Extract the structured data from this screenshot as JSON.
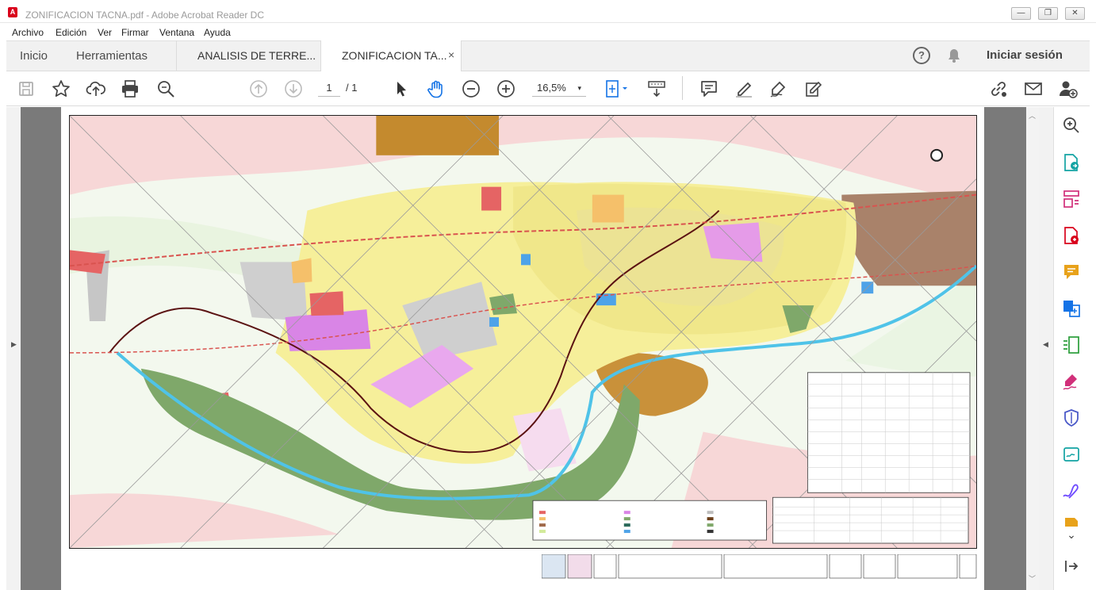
{
  "window": {
    "title": "ZONIFICACION TACNA.pdf - Adobe Acrobat Reader DC",
    "minimize": "—",
    "restore": "❐",
    "close": "✕"
  },
  "menu": [
    "Archivo",
    "Edición",
    "Ver",
    "Firmar",
    "Ventana",
    "Ayuda"
  ],
  "tabs": {
    "home": "Inicio",
    "tools": "Herramientas",
    "documents": [
      {
        "label": "ANALISIS DE TERRE...",
        "active": false
      },
      {
        "label": "ZONIFICACION TA...",
        "active": true,
        "close": "×"
      }
    ],
    "help": "?",
    "signin": "Iniciar sesión"
  },
  "toolbar": {
    "page_current": "1",
    "page_total": "/ 1",
    "zoom": "16,5%",
    "zoom_caret": "▾"
  },
  "icons": {
    "toolbar": [
      "save-icon",
      "star-icon",
      "upload-cloud-icon",
      "print-icon",
      "search-zoom-icon",
      "prev-page-icon",
      "next-page-icon",
      "select-cursor-icon",
      "hand-icon",
      "zoom-out-icon",
      "zoom-in-icon",
      "fit-page-icon",
      "scroll-mode-icon",
      "comment-icon",
      "highlight-icon",
      "sign-icon",
      "stamp-icon",
      "link-share-icon",
      "email-icon",
      "add-user-icon"
    ],
    "tools_pane": [
      "zoom-search-icon",
      "export-pdf-icon",
      "organize-pages-icon",
      "create-pdf-icon",
      "comment-tool-icon",
      "combine-files-icon",
      "compress-icon",
      "fill-sign-icon",
      "protect-icon",
      "send-sign-icon",
      "edit-pen-icon",
      "more-tools-icon"
    ]
  },
  "colors": {
    "accent_red": "#d9001b",
    "tool_blue": "#1473e6",
    "tool_pink": "#d1307a",
    "tool_teal": "#12a3a3",
    "tool_orange": "#e8a21a",
    "tool_purple": "#6e4aff"
  }
}
